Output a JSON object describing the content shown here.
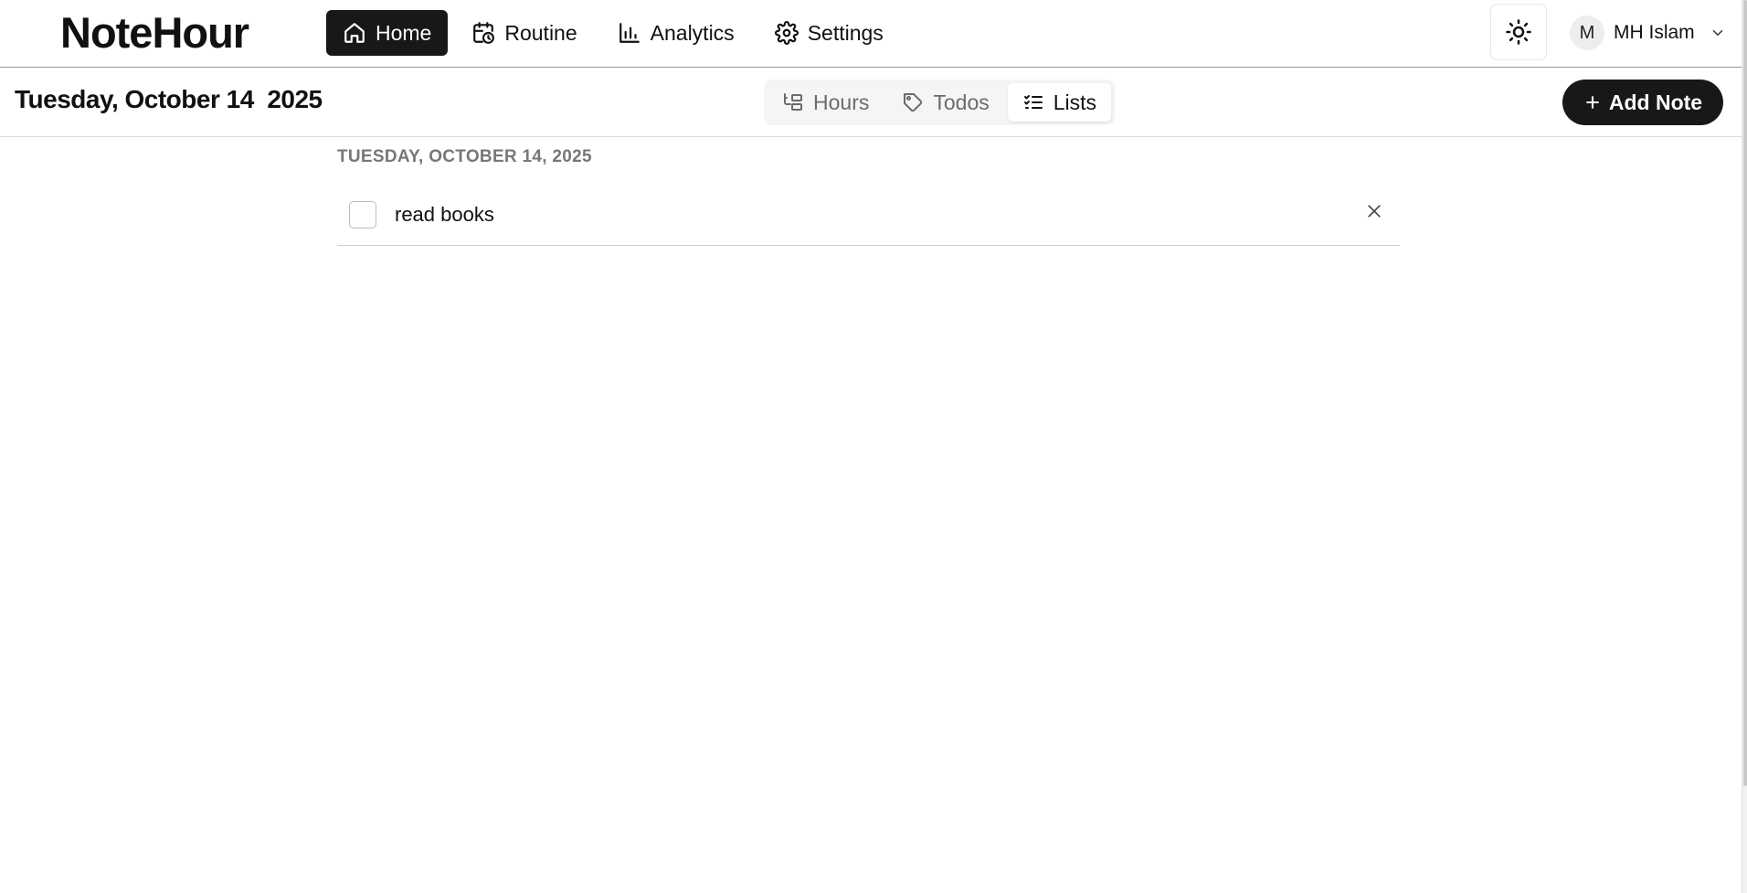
{
  "app": {
    "brand": "NoteHour"
  },
  "nav": {
    "items": [
      {
        "label": "Home",
        "icon": "home-icon",
        "active": true
      },
      {
        "label": "Routine",
        "icon": "calendar-clock-icon",
        "active": false
      },
      {
        "label": "Analytics",
        "icon": "bar-chart-icon",
        "active": false
      },
      {
        "label": "Settings",
        "icon": "gear-icon",
        "active": false
      }
    ]
  },
  "header": {
    "theme_icon": "sun-icon",
    "user": {
      "initial": "M",
      "name": "MH Islam",
      "dropdown_icon": "chevron-down-icon"
    }
  },
  "subheader": {
    "date_title": "Tuesday, October 14  2025",
    "tabs": [
      {
        "label": "Hours",
        "icon": "hours-icon",
        "active": false
      },
      {
        "label": "Todos",
        "icon": "tag-icon",
        "active": false
      },
      {
        "label": "Lists",
        "icon": "checklist-icon",
        "active": true
      }
    ],
    "add_note_label": "Add Note"
  },
  "list": {
    "date_heading": "TUESDAY, OCTOBER 14, 2025",
    "items": [
      {
        "text": "read books",
        "checked": false
      }
    ]
  },
  "colors": {
    "primary_dark": "#181818",
    "muted_text": "#777777",
    "tab_bg": "#f5f5f5"
  }
}
